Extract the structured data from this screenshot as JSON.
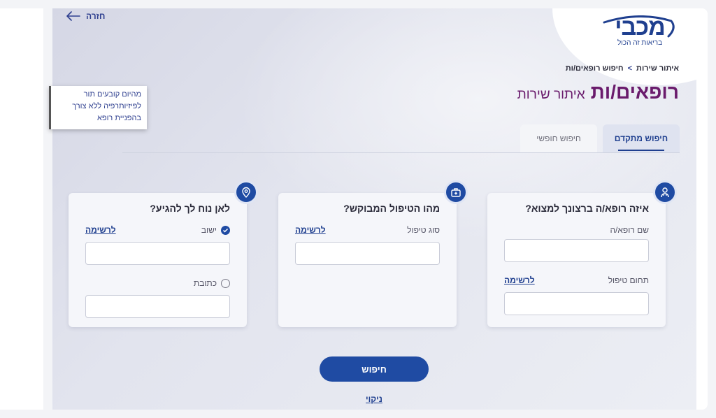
{
  "header": {
    "back_label": "חזרה",
    "logo_name": "מכבי",
    "logo_tagline": "בריאות זה הכול"
  },
  "breadcrumb": {
    "items": [
      "איתור שירות",
      "חיפוש רופאים/ות"
    ],
    "separator": ">"
  },
  "page": {
    "title": "רופאים/ות",
    "subtitle": "איתור שירות"
  },
  "tabs": [
    {
      "label": "חיפוש מתקדם",
      "active": true
    },
    {
      "label": "חיפוש חופשי",
      "active": false
    }
  ],
  "cards": {
    "doctor": {
      "title": "איזה רופא/ה ברצונך למצוא?",
      "name_label": "שם רופא/ה",
      "field_label": "תחום טיפול",
      "list_link": "לרשימה"
    },
    "treatment": {
      "title": "מהו הטיפול המבוקש?",
      "type_label": "סוג טיפול",
      "list_link": "לרשימה"
    },
    "location": {
      "title": "לאן נוח לך להגיע?",
      "settlement_label": "ישוב",
      "address_label": "כתובת",
      "list_link": "לרשימה"
    }
  },
  "actions": {
    "search_label": "חיפוש",
    "clear_label": "ניקוי"
  },
  "promo": {
    "lines": [
      "מהיום קובעים תור",
      "לפיזיותרפיה ללא צורך",
      "בהפניית רופא"
    ]
  },
  "colors": {
    "primary": "#1f4ba3",
    "title": "#6a1b6c",
    "link": "#1f3f8f"
  }
}
